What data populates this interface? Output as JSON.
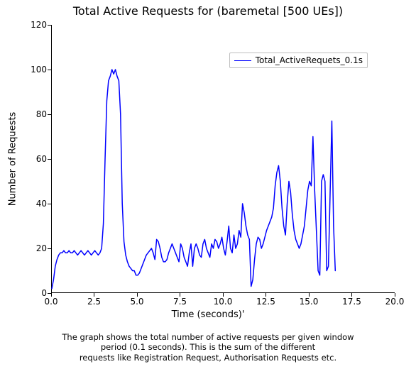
{
  "chart_data": {
    "type": "line",
    "title": "Total Active Requests for (baremetal [500 UEs])",
    "xlabel": "Time (seconds)'",
    "ylabel": "Number of Requests",
    "xlim": [
      0,
      20
    ],
    "ylim": [
      0,
      120
    ],
    "x_ticks": [
      0.0,
      2.5,
      5.0,
      7.5,
      10.0,
      12.5,
      15.0,
      17.5,
      20.0
    ],
    "y_ticks": [
      0,
      20,
      40,
      60,
      80,
      100,
      120
    ],
    "legend": {
      "entries": [
        "Total_ActiveRequets_0.1s"
      ]
    },
    "caption_line1": "The graph shows the total number of active requests per given window",
    "caption_line2": "period (0.1 seconds). This is the sum of the different",
    "caption_line3": "requests like Registration Request, Authorisation Requests etc.",
    "series": [
      {
        "name": "Total_ActiveRequets_0.1s",
        "color": "#0000ff",
        "x": [
          0.0,
          0.1,
          0.2,
          0.3,
          0.4,
          0.5,
          0.6,
          0.7,
          0.8,
          0.9,
          1.0,
          1.1,
          1.2,
          1.3,
          1.4,
          1.5,
          1.6,
          1.7,
          1.8,
          1.9,
          2.0,
          2.1,
          2.2,
          2.3,
          2.4,
          2.5,
          2.6,
          2.7,
          2.8,
          2.9,
          3.0,
          3.1,
          3.2,
          3.3,
          3.4,
          3.5,
          3.6,
          3.7,
          3.8,
          3.9,
          4.0,
          4.1,
          4.2,
          4.3,
          4.4,
          4.5,
          4.6,
          4.7,
          4.8,
          4.9,
          5.0,
          5.1,
          5.2,
          5.3,
          5.4,
          5.5,
          5.6,
          5.7,
          5.8,
          5.9,
          6.0,
          6.1,
          6.2,
          6.3,
          6.4,
          6.5,
          6.6,
          6.7,
          6.8,
          6.9,
          7.0,
          7.1,
          7.2,
          7.3,
          7.4,
          7.5,
          7.6,
          7.7,
          7.8,
          7.9,
          8.0,
          8.1,
          8.2,
          8.3,
          8.4,
          8.5,
          8.6,
          8.7,
          8.8,
          8.9,
          9.0,
          9.1,
          9.2,
          9.3,
          9.4,
          9.5,
          9.6,
          9.7,
          9.8,
          9.9,
          10.0,
          10.1,
          10.2,
          10.3,
          10.4,
          10.5,
          10.6,
          10.7,
          10.8,
          10.9,
          11.0,
          11.1,
          11.2,
          11.3,
          11.4,
          11.5,
          11.6,
          11.7,
          11.8,
          11.9,
          12.0,
          12.1,
          12.2,
          12.3,
          12.4,
          12.5,
          12.6,
          12.7,
          12.8,
          12.9,
          13.0,
          13.1,
          13.2,
          13.3,
          13.4,
          13.5,
          13.6,
          13.7,
          13.8,
          13.9,
          14.0,
          14.1,
          14.2,
          14.3,
          14.4,
          14.5,
          14.6,
          14.7,
          14.8,
          14.9,
          15.0,
          15.1,
          15.2,
          15.3,
          15.4,
          15.5,
          15.6,
          15.7,
          15.8,
          15.9,
          16.0,
          16.1,
          16.2,
          16.3,
          16.4,
          16.5
        ],
        "y": [
          2,
          6,
          12,
          15,
          17,
          18,
          18,
          19,
          18,
          18,
          19,
          18,
          18,
          19,
          18,
          17,
          18,
          19,
          18,
          17,
          18,
          19,
          18,
          17,
          18,
          19,
          18,
          17,
          18,
          20,
          31,
          60,
          86,
          95,
          97,
          100,
          98,
          100,
          97,
          95,
          80,
          40,
          23,
          17,
          14,
          12,
          11,
          10,
          10,
          8,
          8,
          9,
          11,
          13,
          15,
          17,
          18,
          19,
          20,
          18,
          15,
          24,
          23,
          20,
          16,
          14,
          14,
          15,
          18,
          20,
          22,
          20,
          18,
          16,
          14,
          22,
          20,
          16,
          14,
          12,
          18,
          22,
          12,
          20,
          22,
          20,
          17,
          16,
          22,
          24,
          20,
          18,
          16,
          22,
          20,
          24,
          23,
          20,
          22,
          25,
          20,
          17,
          23,
          30,
          20,
          18,
          26,
          20,
          22,
          28,
          25,
          40,
          36,
          30,
          26,
          24,
          3,
          6,
          15,
          22,
          25,
          24,
          20,
          22,
          25,
          28,
          30,
          32,
          34,
          38,
          48,
          54,
          57,
          50,
          38,
          30,
          26,
          40,
          50,
          45,
          35,
          28,
          24,
          22,
          20,
          22,
          26,
          30,
          38,
          46,
          50,
          48,
          70,
          46,
          28,
          10,
          8,
          50,
          53,
          50,
          10,
          12,
          45,
          77,
          30,
          10
        ]
      }
    ]
  }
}
